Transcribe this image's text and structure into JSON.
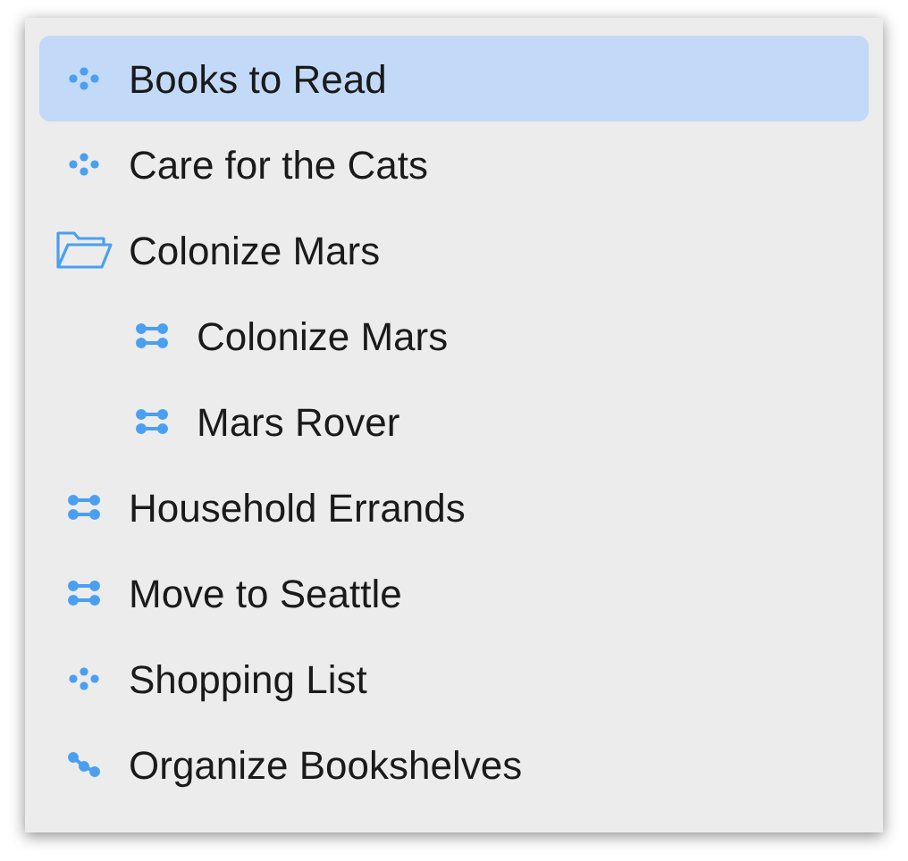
{
  "items": [
    {
      "label": "Books to Read",
      "kind": "single",
      "selected": true
    },
    {
      "label": "Care for the Cats",
      "kind": "single",
      "selected": false
    },
    {
      "label": "Colonize Mars",
      "kind": "folder",
      "selected": false,
      "children": [
        {
          "label": "Colonize Mars",
          "kind": "parallel",
          "selected": false
        },
        {
          "label": "Mars Rover",
          "kind": "parallel",
          "selected": false
        }
      ]
    },
    {
      "label": "Household Errands",
      "kind": "parallel",
      "selected": false
    },
    {
      "label": "Move to Seattle",
      "kind": "parallel",
      "selected": false
    },
    {
      "label": "Shopping List",
      "kind": "single",
      "selected": false
    },
    {
      "label": "Organize Bookshelves",
      "kind": "sequential",
      "selected": false
    }
  ]
}
